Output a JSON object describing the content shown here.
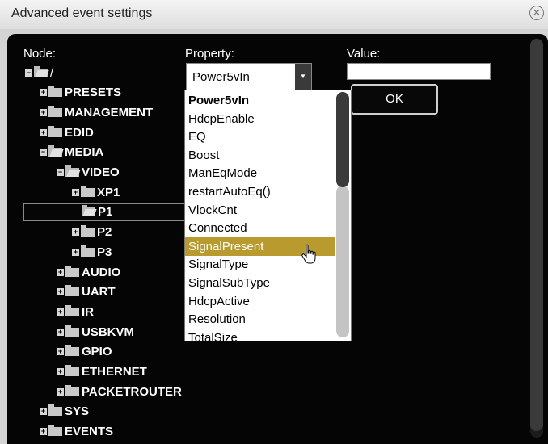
{
  "window": {
    "title": "Advanced event settings"
  },
  "labels": {
    "node": "Node:",
    "property": "Property:",
    "value": "Value:"
  },
  "tree": [
    {
      "label": "/",
      "level": 0,
      "expander": "minus",
      "folder": "open"
    },
    {
      "label": "PRESETS",
      "level": 1,
      "expander": "plus",
      "folder": "closed"
    },
    {
      "label": "MANAGEMENT",
      "level": 1,
      "expander": "plus",
      "folder": "closed"
    },
    {
      "label": "EDID",
      "level": 1,
      "expander": "plus",
      "folder": "closed"
    },
    {
      "label": "MEDIA",
      "level": 1,
      "expander": "minus",
      "folder": "open"
    },
    {
      "label": "VIDEO",
      "level": 2,
      "expander": "minus",
      "folder": "open"
    },
    {
      "label": "XP1",
      "level": 3,
      "expander": "plus",
      "folder": "closed"
    },
    {
      "label": "P1",
      "level": 3,
      "expander": "none",
      "folder": "open",
      "selected": true
    },
    {
      "label": "P2",
      "level": 3,
      "expander": "plus",
      "folder": "closed"
    },
    {
      "label": "P3",
      "level": 3,
      "expander": "plus",
      "folder": "closed"
    },
    {
      "label": "AUDIO",
      "level": 2,
      "expander": "plus",
      "folder": "closed"
    },
    {
      "label": "UART",
      "level": 2,
      "expander": "plus",
      "folder": "closed"
    },
    {
      "label": "IR",
      "level": 2,
      "expander": "plus",
      "folder": "closed"
    },
    {
      "label": "USBKVM",
      "level": 2,
      "expander": "plus",
      "folder": "closed"
    },
    {
      "label": "GPIO",
      "level": 2,
      "expander": "plus",
      "folder": "closed"
    },
    {
      "label": "ETHERNET",
      "level": 2,
      "expander": "plus",
      "folder": "closed"
    },
    {
      "label": "PACKETROUTER",
      "level": 2,
      "expander": "plus",
      "folder": "closed"
    },
    {
      "label": "SYS",
      "level": 1,
      "expander": "plus",
      "folder": "closed"
    },
    {
      "label": "EVENTS",
      "level": 1,
      "expander": "plus",
      "folder": "closed"
    }
  ],
  "property_select": {
    "selected": "Power5vIn",
    "options": [
      "Power5vIn",
      "HdcpEnable",
      "EQ",
      "Boost",
      "ManEqMode",
      "restartAutoEq()",
      "VlockCnt",
      "Connected",
      "SignalPresent",
      "SignalType",
      "SignalSubType",
      "HdcpActive",
      "Resolution",
      "TotalSize"
    ],
    "highlighted": "SignalPresent"
  },
  "value_input": {
    "value": ""
  },
  "ok_button": {
    "label": "OK"
  },
  "icons": {
    "close": "close-circle-icon",
    "expand": "plus-box-icon",
    "collapse": "minus-box-icon",
    "folder": "folder-icon",
    "cursor": "hand-pointer-icon",
    "dropdown": "chevron-down-icon"
  },
  "colors": {
    "highlight": "#b89a2e",
    "panel": "#050505"
  }
}
